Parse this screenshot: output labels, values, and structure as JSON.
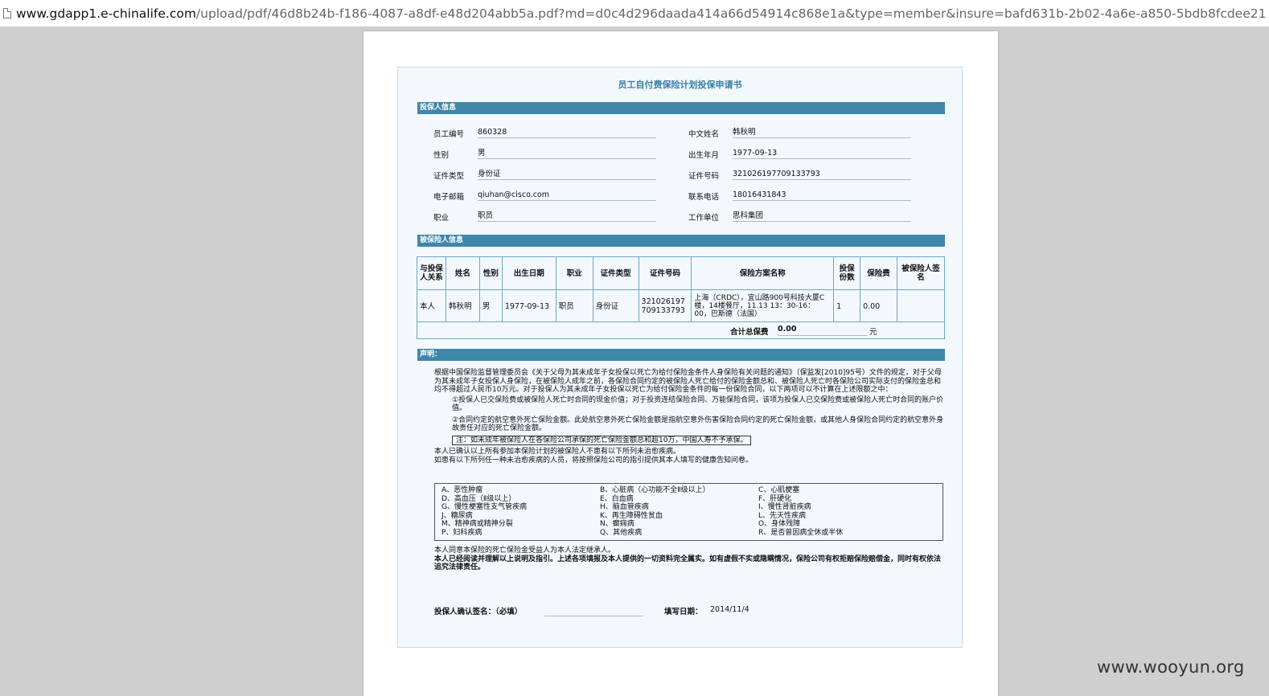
{
  "browser": {
    "url_host": "www.gdapp1.e-chinalife.com",
    "url_path": "/upload/pdf/46d8b24b-f186-4087-a8df-e48d204abb5a.pdf?md=d0c4d296daada414a66d54914c868e1a&type=member&insure=bafd631b-2b02-4a6e-a850-5bdb8fcdee21"
  },
  "form": {
    "title": "员工自付费保险计划投保申请书",
    "applicant_section": "投保人信息",
    "applicant": {
      "employee_id_label": "员工编号",
      "employee_id": "860328",
      "chinese_name_label": "中文姓名",
      "chinese_name": "韩秋明",
      "gender_label": "性别",
      "gender": "男",
      "birth_label": "出生年月",
      "birth": "1977-09-13",
      "id_type_label": "证件类型",
      "id_type": "身份证",
      "id_number_label": "证件号码",
      "id_number": "321026197709133793",
      "email_label": "电子邮箱",
      "email": "qiuhan@cisco.com",
      "phone_label": "联系电话",
      "phone": "18016431843",
      "occupation_label": "职业",
      "occupation": "职员",
      "employer_label": "工作单位",
      "employer": "思科集团"
    },
    "insured_section": "被保险人信息",
    "insured_table": {
      "headers": [
        "与投保人关系",
        "姓名",
        "性别",
        "出生日期",
        "职业",
        "证件类型",
        "证件号码",
        "保险方案名称",
        "投保份数",
        "保险费",
        "被保险人签名"
      ],
      "rows": [
        [
          "本人",
          "韩秋明",
          "男",
          "1977-09-13",
          "职员",
          "身份证",
          "321026197709133793",
          "上海（CRDC），宜山路900号科技大厦C楼，14楼餐厅，11.13 13：30-16：00，巴斯德（法国）",
          "1",
          "0.00",
          ""
        ]
      ],
      "total_label": "合计总保费",
      "total_value": "0.00",
      "total_unit": "元"
    },
    "declaration_section": "声明：",
    "declaration": {
      "p1": "根据中国保险监督管理委员会《关于父母为其未成年子女投保以死亡为给付保险金条件人身保险有关问题的通知》（保监发[2010]95号）文件的规定，对于父母为其未成年子女投保人身保险，在被保险人成年之前，各保险合同约定的被保险人死亡给付的保险金额总和、被保险人死亡时各保险公司实际支付的保险金总和均不得超过人民币10万元。对于投保人为其未成年子女投保以死亡为给付保险金条件的每一份保险合同，以下两项可以不计算在上述限额之中：",
      "p2": "①投保人已交保险费或被保险人死亡时合同的现金价值；对于投资连结保险合同、万能保险合同，该项为投保人已交保险费或被保险人死亡时合同的账户价值。",
      "p3": "②合同约定的航空意外死亡保险金额。此处航空意外死亡保险金额是指航空意外伤害保险合同约定的死亡保险金额，或其他人身保险合同约定的航空意外身故责任对应的死亡保险金额。",
      "note": "注：如未成年被保险人在各保险公司承保的死亡保险金额总和超10万，中国人寿不予承保。",
      "p4": "本人已确认以上所有参加本保险计划的被保险人不患有以下所列未治愈疾病。",
      "p5": "如患有以下所列任一种未治愈疾病的人员，将按照保险公司的指引提供其本人填写的健康告知问卷。",
      "diseases": [
        [
          "A、恶性肿瘤",
          "D、高血压（Ⅱ级以上）",
          "G、慢性梗塞性支气管疾病",
          "J、糖尿病",
          "M、精神病或精神分裂",
          "P、妇科疾病"
        ],
        [
          "B、心脏病（心功能不全Ⅱ级以上）",
          "E、白血病",
          "H、脑血管疾病",
          "K、再生障碍性贫血",
          "N、癫痫病",
          "Q、其他疾病"
        ],
        [
          "C、心肌梗塞",
          "F、肝硬化",
          "I、慢性肾脏疾病",
          "L、先天性疾病",
          "O、身体残障",
          "R、是否曾因病全休或半休"
        ]
      ],
      "p6": "本人同意本保险的死亡保险金受益人为本人法定继承人。",
      "p7": "本人已经阅读并理解以上说明及指引。上述各项填报及本人提供的一切资料完全属实。如有虚假不实或隐瞒情况，保险公司有权拒赔保险赔偿金，同时有权依法追究法律责任。"
    },
    "signature_label": "投保人确认签名：（必填）",
    "date_label": "填写日期：",
    "date_value": "2014/11/4"
  },
  "watermark": "www.wooyun.org"
}
